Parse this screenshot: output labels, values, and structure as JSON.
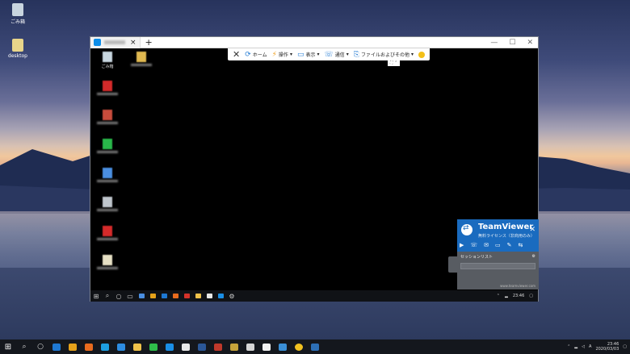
{
  "desktop": {
    "icons": [
      {
        "label": "ごみ箱",
        "icon": "recycle-bin-icon"
      },
      {
        "label": "desktop",
        "icon": "folder-icon"
      }
    ]
  },
  "teamviewer_window": {
    "tab_close": "×",
    "new_tab": "+",
    "window_controls": {
      "minimize": "—",
      "maximize": "☐",
      "close": "✕"
    },
    "toolbar": {
      "close": "✕",
      "items": [
        {
          "label": "ホーム",
          "icon": "refresh-icon"
        },
        {
          "label": "操作",
          "icon": "lightning-icon"
        },
        {
          "label": "表示",
          "icon": "monitor-icon"
        },
        {
          "label": "通信",
          "icon": "chat-icon"
        },
        {
          "label": "ファイルおよびその他",
          "icon": "file-transfer-icon"
        }
      ]
    },
    "remote_desktop": {
      "icons": [
        {
          "label": "ごみ箱",
          "color": "#c8d6e0"
        },
        {
          "label": "",
          "color": "#e0b850"
        },
        {
          "label": "",
          "color": "#d42a2a"
        },
        {
          "label": "",
          "color": "#c84c3c"
        },
        {
          "label": "",
          "color": "#29b84a"
        },
        {
          "label": "",
          "color": "#4a8ee0"
        },
        {
          "label": "",
          "color": "#bfc6cc"
        },
        {
          "label": "",
          "color": "#d42a2a"
        },
        {
          "label": "",
          "color": "#e6e0c4"
        }
      ],
      "taskbar_time": "23:46"
    }
  },
  "teamviewer_panel": {
    "brand": "TeamViewer",
    "subtitle": "無料ライセンス（非商用のみ）",
    "close": "✕",
    "session_list_title": "セッションリスト",
    "footer": "www.teamviewer.com"
  },
  "taskbar": {
    "time": "23:46",
    "date": "2020/03/03",
    "apps": [
      {
        "name": "edge",
        "color": "#1e78d2"
      },
      {
        "name": "chrome",
        "color": "#e6a21a"
      },
      {
        "name": "firefox",
        "color": "#e86b1e"
      },
      {
        "name": "skype",
        "color": "#1d9ee0"
      },
      {
        "name": "download",
        "color": "#2d8ce0"
      },
      {
        "name": "explorer",
        "color": "#f0c24a"
      },
      {
        "name": "line",
        "color": "#2fbd4a"
      },
      {
        "name": "teamviewer",
        "color": "#1a8fe6"
      },
      {
        "name": "document",
        "color": "#e8e8e8"
      },
      {
        "name": "word",
        "color": "#2b5797"
      },
      {
        "name": "filezilla",
        "color": "#c0392b"
      },
      {
        "name": "tool",
        "color": "#c6a33a"
      },
      {
        "name": "app",
        "color": "#d6d6d6"
      },
      {
        "name": "app2",
        "color": "#f2f2f2"
      },
      {
        "name": "photos",
        "color": "#3a8fd6"
      },
      {
        "name": "smiley",
        "color": "#f0c020"
      },
      {
        "name": "photoshop",
        "color": "#2d6fb5"
      }
    ]
  }
}
